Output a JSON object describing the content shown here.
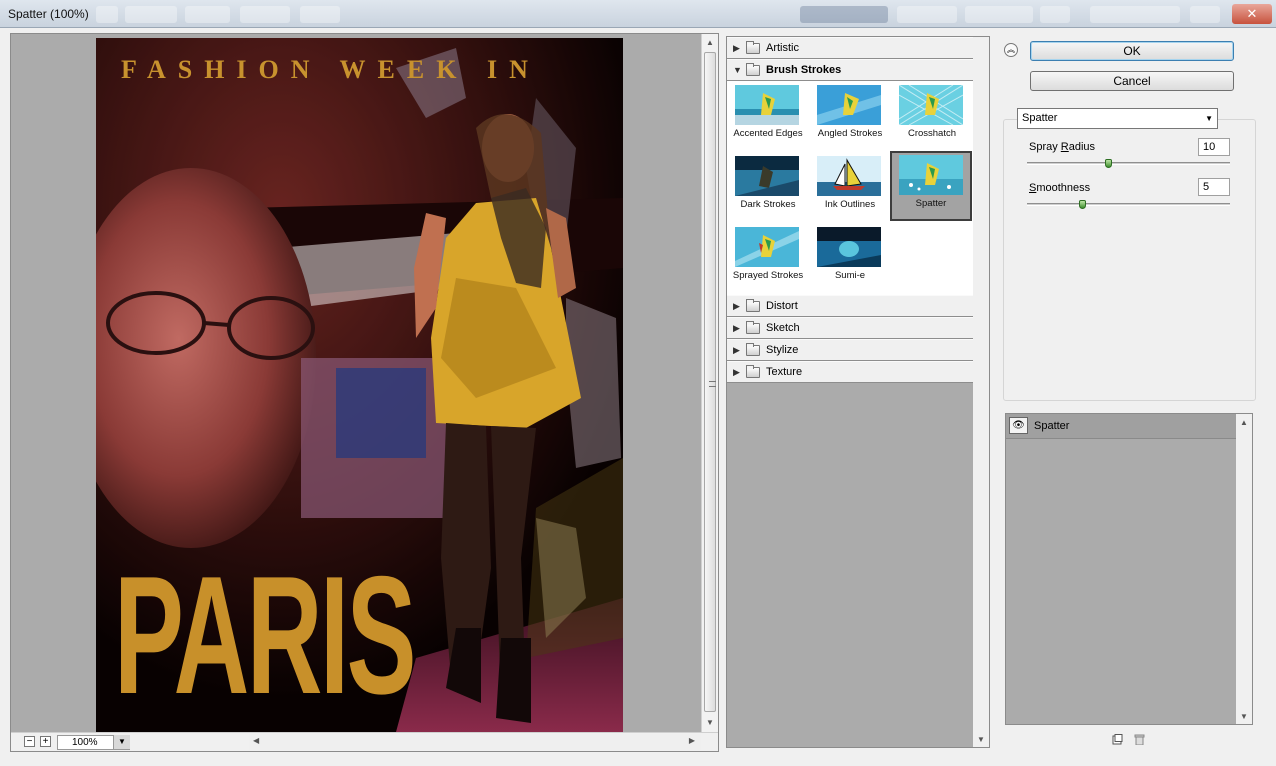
{
  "window": {
    "title": "Spatter (100%)"
  },
  "preview": {
    "zoom_value": "100%",
    "zoom_out_label": "−",
    "zoom_in_label": "+",
    "image_text": {
      "top_banner": "FASHION WEEK IN",
      "big_word": "PARIS"
    }
  },
  "filter_browser": {
    "categories_above": [
      {
        "label": "Artistic",
        "expanded": false
      }
    ],
    "open_category": {
      "label": "Brush Strokes",
      "expanded": true
    },
    "thumbnails": [
      {
        "label": "Accented Edges",
        "selected": false
      },
      {
        "label": "Angled Strokes",
        "selected": false
      },
      {
        "label": "Crosshatch",
        "selected": false
      },
      {
        "label": "Dark Strokes",
        "selected": false
      },
      {
        "label": "Ink Outlines",
        "selected": false
      },
      {
        "label": "Spatter",
        "selected": true
      },
      {
        "label": "Sprayed Strokes",
        "selected": false
      },
      {
        "label": "Sumi-e",
        "selected": false
      }
    ],
    "categories_below": [
      {
        "label": "Distort"
      },
      {
        "label": "Sketch"
      },
      {
        "label": "Stylize"
      },
      {
        "label": "Texture"
      }
    ]
  },
  "buttons": {
    "ok": "OK",
    "cancel": "Cancel"
  },
  "settings": {
    "filter_select": "Spatter",
    "spray_radius": {
      "label_pre": "Spray ",
      "label_u": "R",
      "label_post": "adius",
      "value": "10",
      "fraction": 0.4
    },
    "smoothness": {
      "label_pre": "",
      "label_u": "S",
      "label_post": "moothness",
      "value": "5",
      "fraction": 0.27
    }
  },
  "layers": {
    "items": [
      {
        "name": "Spatter",
        "visible": true
      }
    ]
  },
  "icons": {
    "collapse": "double-chevron-up-icon",
    "eye": "eye-icon",
    "new_layer": "new-effect-layer-icon",
    "delete_layer": "trash-icon"
  },
  "colors": {
    "accent_green": "#3e8f2f",
    "selection_gray": "#a3a3a3",
    "panel_gray": "#ababab"
  }
}
